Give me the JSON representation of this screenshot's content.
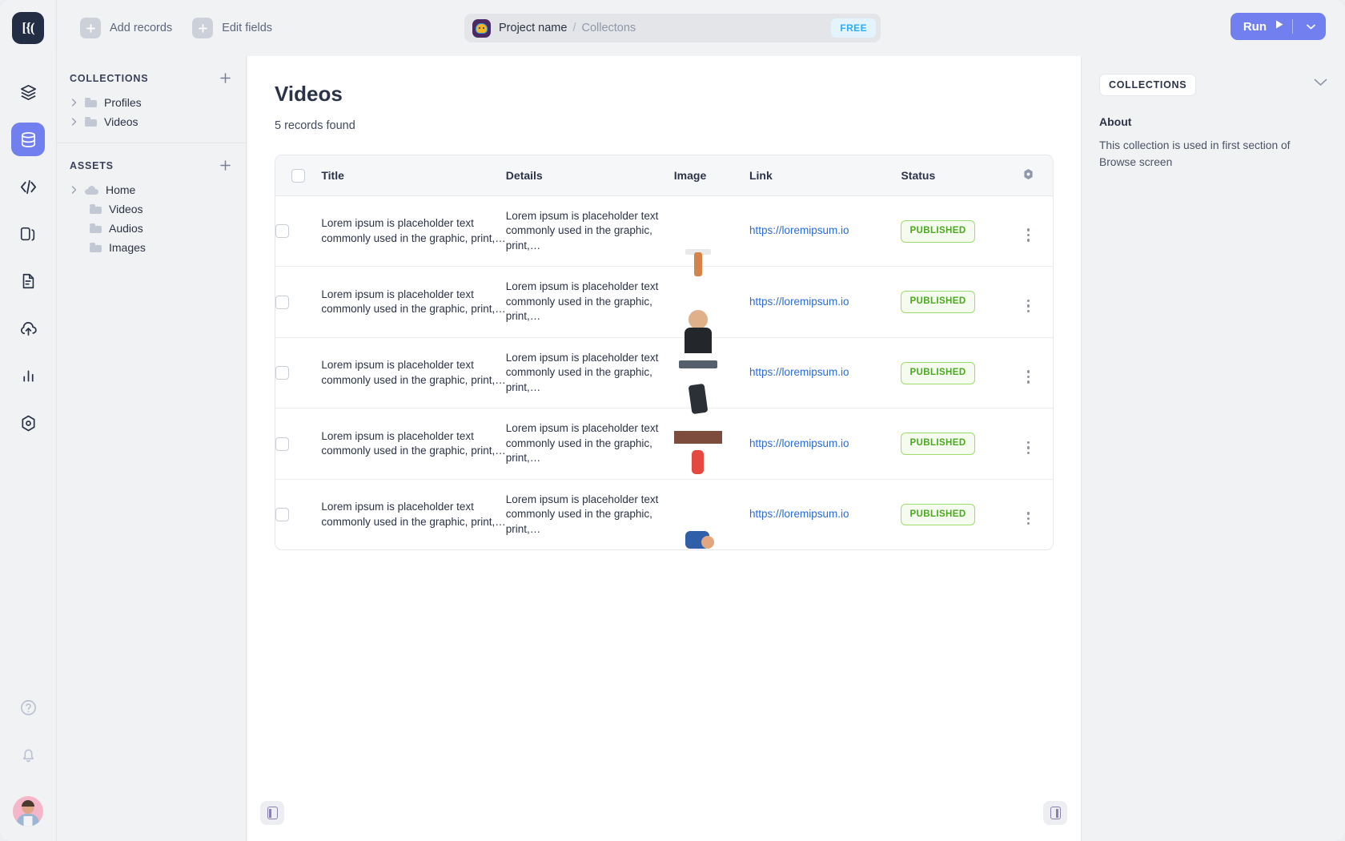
{
  "topbar": {
    "logo_text": "[{(",
    "actions": [
      {
        "label": "Add records",
        "icon": "plus-icon"
      },
      {
        "label": "Edit fields",
        "icon": "plus-icon"
      }
    ],
    "breadcrumb": {
      "project": "Project name",
      "separator": "/",
      "section": "Collectons"
    },
    "plan_badge": "FREE",
    "run": {
      "label": "Run",
      "play_icon": "play-icon",
      "caret_icon": "chevron-down-icon"
    }
  },
  "rail": {
    "items": [
      {
        "name": "layers-icon",
        "active": false
      },
      {
        "name": "database-icon",
        "active": true
      },
      {
        "name": "code-icon",
        "active": false
      },
      {
        "name": "copy-icon",
        "active": false
      },
      {
        "name": "document-icon",
        "active": false
      },
      {
        "name": "cloud-upload-icon",
        "active": false
      },
      {
        "name": "bar-chart-icon",
        "active": false
      },
      {
        "name": "settings-hex-icon",
        "active": false
      }
    ],
    "bottom": [
      {
        "name": "help-circle-icon"
      },
      {
        "name": "bell-icon"
      }
    ]
  },
  "sidebar": {
    "collections": {
      "title": "COLLECTIONS",
      "add_icon": "plus-icon",
      "items": [
        {
          "label": "Profiles",
          "icon": "folder-icon",
          "caret": "chevron-right-icon"
        },
        {
          "label": "Videos",
          "icon": "folder-icon",
          "caret": "chevron-right-icon"
        }
      ]
    },
    "assets": {
      "title": "ASSETS",
      "add_icon": "plus-icon",
      "items": [
        {
          "label": "Home",
          "icon": "cloud-icon",
          "caret": "chevron-right-icon",
          "indent": false
        },
        {
          "label": "Videos",
          "icon": "folder-icon",
          "indent": true
        },
        {
          "label": "Audios",
          "icon": "folder-icon",
          "indent": true
        },
        {
          "label": "Images",
          "icon": "folder-icon",
          "indent": true
        }
      ]
    }
  },
  "main": {
    "title": "Videos",
    "records_found": "5 records found",
    "table": {
      "columns": [
        "Title",
        "Details",
        "Image",
        "Link",
        "Status"
      ],
      "header_gear_icon": "settings-hex-icon",
      "select_all_checkbox": false,
      "rows": [
        {
          "title": "Lorem ipsum is placeholder text commonly used in the graphic, print,…",
          "details": "Lorem ipsum is placeholder text commonly used in the graphic, print,…",
          "image": "athlete-barbell-press-thumbnail",
          "link": "https://loremipsum.io",
          "status": "PUBLISHED"
        },
        {
          "title": "Lorem ipsum is placeholder text commonly used in the graphic, print,…",
          "details": "Lorem ipsum is placeholder text commonly used in the graphic, print,…",
          "image": "athlete-portrait-thumbnail",
          "link": "https://loremipsum.io",
          "status": "PUBLISHED"
        },
        {
          "title": "Lorem ipsum is placeholder text commonly used in the graphic, print,…",
          "details": "Lorem ipsum is placeholder text commonly used in the graphic, print,…",
          "image": "runner-underpass-thumbnail",
          "link": "https://loremipsum.io",
          "status": "PUBLISHED"
        },
        {
          "title": "Lorem ipsum is placeholder text commonly used in the graphic, print,…",
          "details": "Lorem ipsum is placeholder text commonly used in the graphic, print,…",
          "image": "sprinter-on-track-thumbnail",
          "link": "https://loremipsum.io",
          "status": "PUBLISHED"
        },
        {
          "title": "Lorem ipsum is placeholder text commonly used in the graphic, print,…",
          "details": "Lorem ipsum is placeholder text commonly used in the graphic, print,…",
          "image": "athlete-resting-track-thumbnail",
          "link": "https://loremipsum.io",
          "status": "PUBLISHED"
        }
      ]
    }
  },
  "rightpane": {
    "tag": "COLLECTIONS",
    "collapse_icon": "chevron-down-icon",
    "about_label": "About",
    "about_text": "This collection is used in first section of Browse screen"
  },
  "colors": {
    "accent": "#7280ef",
    "link": "#2a6bd6",
    "status_published_text": "#4aa91d",
    "status_published_border": "#9fdc6e",
    "free_badge_text": "#2badfc",
    "free_badge_bg": "#e4f4fe"
  }
}
